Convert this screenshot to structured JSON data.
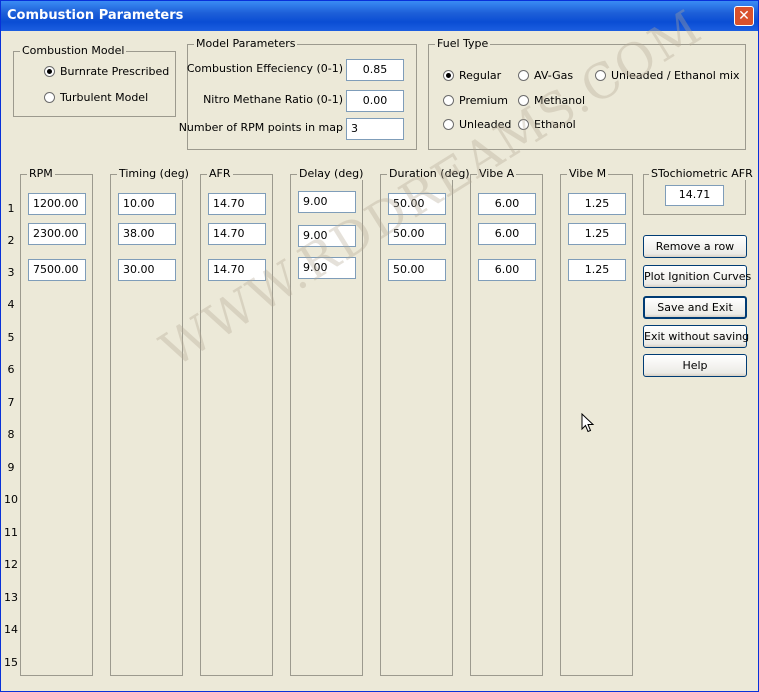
{
  "window": {
    "title": "Combustion Parameters",
    "close_glyph": "✕"
  },
  "combustion_model": {
    "legend": "Combustion Model",
    "options": [
      {
        "label": "Burnrate Prescribed",
        "checked": true
      },
      {
        "label": "Turbulent Model",
        "checked": false
      }
    ]
  },
  "model_params": {
    "legend": "Model Parameters",
    "fields": [
      {
        "label": "Combustion Effeciency (0-1)",
        "value": "0.85"
      },
      {
        "label": "Nitro Methane Ratio (0-1)",
        "value": "0.00"
      },
      {
        "label": "Number of RPM points in map",
        "value": "3"
      }
    ]
  },
  "fuel_type": {
    "legend": "Fuel Type",
    "options": [
      {
        "label": "Regular",
        "checked": true
      },
      {
        "label": "AV-Gas",
        "checked": false
      },
      {
        "label": "Unleaded / Ethanol mix",
        "checked": false
      },
      {
        "label": "Premium",
        "checked": false
      },
      {
        "label": "Methanol",
        "checked": false
      },
      {
        "label": "Unleaded",
        "checked": false
      },
      {
        "label": "Ethanol",
        "checked": false
      }
    ]
  },
  "row_numbers": [
    "1",
    "2",
    "3",
    "4",
    "5",
    "6",
    "7",
    "8",
    "9",
    "10",
    "11",
    "12",
    "13",
    "14",
    "15"
  ],
  "columns": [
    {
      "header": "RPM",
      "values": [
        "1200.00",
        "2300.00",
        "7500.00"
      ]
    },
    {
      "header": "Timing (deg)",
      "values": [
        "10.00",
        "38.00",
        "30.00"
      ]
    },
    {
      "header": "AFR",
      "values": [
        "14.70",
        "14.70",
        "14.70"
      ]
    },
    {
      "header": "Delay (deg)",
      "values": [
        "9.00",
        "9.00",
        "9.00"
      ]
    },
    {
      "header": "Duration (deg)",
      "values": [
        "50.00",
        "50.00",
        "50.00"
      ]
    },
    {
      "header": "Vibe A",
      "values": [
        "6.00",
        "6.00",
        "6.00"
      ]
    },
    {
      "header": "Vibe M",
      "values": [
        "1.25",
        "1.25",
        "1.25"
      ]
    }
  ],
  "stoich": {
    "legend": "STochiometric AFR",
    "value": "14.71"
  },
  "buttons": {
    "remove_row": "Remove a row",
    "plot_ignition": "Plot Ignition Curves",
    "save_exit": "Save and Exit",
    "exit_no_save": "Exit without saving",
    "help": "Help"
  },
  "watermark": "WWW.RDDREAMS.COM",
  "colors": {
    "titlebar": "#0a4dd4",
    "close": "#d9512c",
    "face": "#ece9d8"
  }
}
